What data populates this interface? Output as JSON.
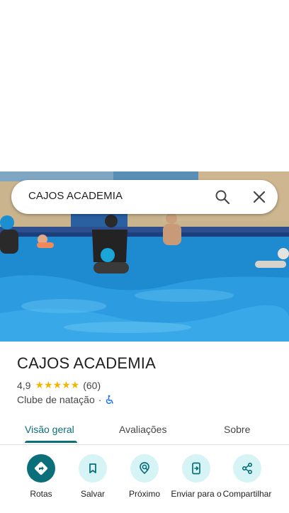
{
  "search": {
    "query": "CAJOS ACADEMIA"
  },
  "place": {
    "name": "CAJOS ACADEMIA",
    "rating": "4,9",
    "stars": "★★★★★",
    "review_count": "(60)",
    "category": "Clube de natação",
    "separator": "·"
  },
  "tabs": [
    {
      "label": "Visão geral",
      "active": true
    },
    {
      "label": "Avaliações",
      "active": false
    },
    {
      "label": "Sobre",
      "active": false
    }
  ],
  "actions": [
    {
      "label": "Rotas",
      "icon": "directions-icon"
    },
    {
      "label": "Salvar",
      "icon": "bookmark-icon"
    },
    {
      "label": "Próximo",
      "icon": "nearby-icon"
    },
    {
      "label": "Enviar para o",
      "icon": "send-to-phone-icon"
    },
    {
      "label": "Compartilhar",
      "icon": "share-icon"
    }
  ],
  "colors": {
    "accent": "#0b6f7a",
    "accent_light": "#d6f3f5",
    "star": "#f2b600",
    "pool": "#1d86c9"
  }
}
